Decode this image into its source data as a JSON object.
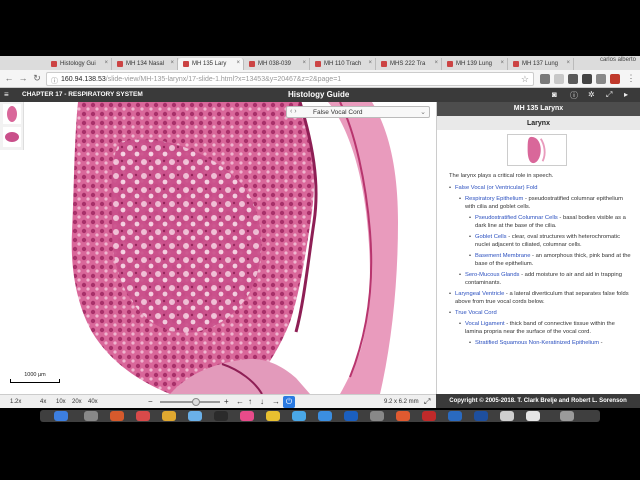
{
  "browser": {
    "tabs": [
      {
        "title": "Histology Gui"
      },
      {
        "title": "MH 134 Nasal"
      },
      {
        "title": "MH 135 Lary",
        "active": true
      },
      {
        "title": "MH 038-039"
      },
      {
        "title": "MH 110 Trach"
      },
      {
        "title": "MHS 222 Tra"
      },
      {
        "title": "MH 139 Lung"
      },
      {
        "title": "MH 137 Lung"
      }
    ],
    "user": "carlos alberto",
    "url_host": "160.94.138.53",
    "url_path": "/slide-view/MH-135-larynx/17-slide-1.html?x=13453&y=20467&z=2&page=1"
  },
  "app": {
    "chapter": "CHAPTER 17 - RESPIRATORY SYSTEM",
    "title": "Histology Guide"
  },
  "viewer": {
    "annotation_select": "False Vocal Cord",
    "scale_label": "1000 µm",
    "zoom_current": "1.2x",
    "zoom_levels": [
      "4x",
      "10x",
      "20x",
      "40x"
    ],
    "dimensions": "9.2 x 6.2 mm"
  },
  "panel": {
    "slide_title": "MH 135 Larynx",
    "section_title": "Larynx",
    "intro": "The larynx plays a critical role in speech.",
    "items": [
      {
        "level": 1,
        "link": "False Vocal (or Ventricular) Fold",
        "text": ""
      },
      {
        "level": 2,
        "link": "Respiratory Epithelium",
        "text": " - pseudostratified columnar epithelium with cilia and goblet cells."
      },
      {
        "level": 3,
        "link": "Pseudostratified Columnar Cells",
        "text": " - basal bodies visible as a dark line at the base of the cilia."
      },
      {
        "level": 3,
        "link": "Goblet Cells",
        "text": " - clear, oval structures with heterochromatic nuclei adjacent to ciliated, columnar cells."
      },
      {
        "level": 3,
        "link": "Basement Membrane",
        "text": " - an amorphous thick, pink band at the base of the epithelium."
      },
      {
        "level": 2,
        "link": "Sero-Mucous Glands",
        "text": " - add moisture to air and aid in trapping contaminants."
      },
      {
        "level": 1,
        "link": "Laryngeal Ventricle",
        "text": " - a lateral diverticulum that separates false folds above from true vocal cords below."
      },
      {
        "level": 1,
        "link": "True Vocal Cord",
        "text": ""
      },
      {
        "level": 2,
        "link": "Vocal Ligament",
        "text": " - thick band of connective tissue within the lamina propria near the surface of the vocal cord."
      },
      {
        "level": 3,
        "link": "Stratified Squamous Non-Keratinized Epithelium",
        "text": " -"
      }
    ],
    "copyright": "Copyright © 2005-2018. T. Clark Brelje and Robert L. Sorenson"
  },
  "colors": {
    "tissue_pink": "#e07aa6",
    "tissue_dark": "#b8356e",
    "link_blue": "#2a4fbf",
    "header_dark": "#3a3a3a"
  }
}
